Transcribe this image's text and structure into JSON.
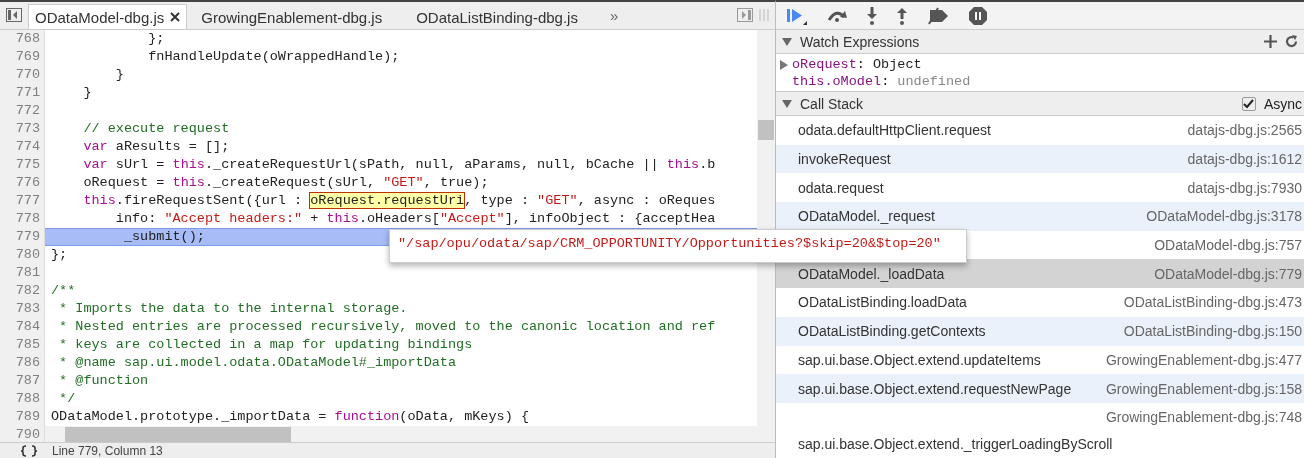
{
  "tabs": [
    {
      "label": "ODataModel-dbg.js",
      "selected": true,
      "closable": true
    },
    {
      "label": "GrowingEnablement-dbg.js",
      "selected": false,
      "closable": false
    },
    {
      "label": "ODataListBinding-dbg.js",
      "selected": false,
      "closable": false
    }
  ],
  "more_tabs": "»",
  "code": {
    "lines": [
      {
        "n": "768",
        "selected": false,
        "tokens": [
          {
            "kind": "plain",
            "text": "            };"
          }
        ]
      },
      {
        "n": "769",
        "selected": false,
        "tokens": [
          {
            "kind": "plain",
            "text": "            fnHandleUpdate(oWrappedHandle);"
          }
        ]
      },
      {
        "n": "770",
        "selected": false,
        "tokens": [
          {
            "kind": "plain",
            "text": "        }"
          }
        ]
      },
      {
        "n": "771",
        "selected": false,
        "tokens": [
          {
            "kind": "plain",
            "text": "    }"
          }
        ]
      },
      {
        "n": "772",
        "selected": false
      },
      {
        "n": "773",
        "selected": false,
        "tokens": [
          {
            "kind": "comment",
            "text": "    // execute request"
          }
        ]
      },
      {
        "n": "774",
        "selected": false,
        "tokens": [
          {
            "kind": "keyword",
            "text": "    var"
          },
          {
            "kind": "plain",
            "text": " aResults = [];"
          }
        ]
      },
      {
        "n": "775",
        "selected": false,
        "tokens": [
          {
            "kind": "keyword",
            "text": "    var"
          },
          {
            "kind": "plain",
            "text": " sUrl = "
          },
          {
            "kind": "keyword",
            "text": "this"
          },
          {
            "kind": "plain",
            "text": "._createRequestUrl(sPath, null, aParams, null, bCache || "
          },
          {
            "kind": "keyword",
            "text": "this"
          },
          {
            "kind": "plain",
            "text": ".b"
          }
        ]
      },
      {
        "n": "776",
        "selected": false,
        "tokens": [
          {
            "kind": "plain",
            "text": "    oRequest = "
          },
          {
            "kind": "keyword",
            "text": "this"
          },
          {
            "kind": "plain",
            "text": "._createRequest(sUrl, "
          },
          {
            "kind": "string",
            "text": "\"GET\""
          },
          {
            "kind": "plain",
            "text": ", true);"
          }
        ]
      },
      {
        "n": "777",
        "selected": false,
        "tokens": [
          {
            "kind": "keyword",
            "text": "    this"
          },
          {
            "kind": "plain",
            "text": ".fireRequestSent({url : "
          },
          {
            "kind": "hover",
            "text": "oRequest.requestUri"
          },
          {
            "kind": "plain",
            "text": ", type : "
          },
          {
            "kind": "string",
            "text": "\"GET\""
          },
          {
            "kind": "plain",
            "text": ", async : oReques"
          }
        ]
      },
      {
        "n": "778",
        "selected": false,
        "tokens": [
          {
            "kind": "plain",
            "text": "        info: "
          },
          {
            "kind": "string",
            "text": "\"Accept headers:\""
          },
          {
            "kind": "plain",
            "text": " + "
          },
          {
            "kind": "keyword",
            "text": "this"
          },
          {
            "kind": "plain",
            "text": ".oHeaders["
          },
          {
            "kind": "string",
            "text": "\"Accept\""
          },
          {
            "kind": "plain",
            "text": "], infoObject : {acceptHea"
          }
        ]
      },
      {
        "n": "779",
        "selected": true,
        "tokens": [
          {
            "kind": "plain",
            "text": "         _submit();"
          }
        ]
      },
      {
        "n": "780",
        "selected": false,
        "tokens": [
          {
            "kind": "plain",
            "text": "};"
          }
        ]
      },
      {
        "n": "781",
        "selected": false
      },
      {
        "n": "782",
        "selected": false,
        "tokens": [
          {
            "kind": "comment",
            "text": "/**"
          }
        ]
      },
      {
        "n": "783",
        "selected": false,
        "tokens": [
          {
            "kind": "comment",
            "text": " * Imports the data to the internal storage."
          }
        ]
      },
      {
        "n": "784",
        "selected": false,
        "tokens": [
          {
            "kind": "comment",
            "text": " * Nested entries are processed recursively, moved to the canonic location and ref"
          }
        ]
      },
      {
        "n": "785",
        "selected": false,
        "tokens": [
          {
            "kind": "comment",
            "text": " * keys are collected in a map for updating bindings"
          }
        ]
      },
      {
        "n": "786",
        "selected": false,
        "tokens": [
          {
            "kind": "comment",
            "text": " * @name sap.ui.model.odata.ODataModel#_importData"
          }
        ]
      },
      {
        "n": "787",
        "selected": false,
        "tokens": [
          {
            "kind": "comment",
            "text": " * @function"
          }
        ]
      },
      {
        "n": "788",
        "selected": false,
        "tokens": [
          {
            "kind": "comment",
            "text": " */"
          }
        ]
      },
      {
        "n": "789",
        "selected": false,
        "tokens": [
          {
            "kind": "plain",
            "text": "ODataModel.prototype._importData = "
          },
          {
            "kind": "keyword",
            "text": "function"
          },
          {
            "kind": "plain",
            "text": "(oData, mKeys) {"
          }
        ]
      }
    ],
    "last_line_number": "790",
    "tooltip": "\"/sap/opu/odata/sap/CRM_OPPORTUNITY/Opportunities?$skip=20&$top=20\""
  },
  "status_bar": {
    "position": "Line 779, Column 13"
  },
  "watch": {
    "title": "Watch Expressions",
    "expanded": true,
    "items": [
      {
        "name": "oRequest",
        "separator": ":",
        "value": "Object",
        "kind": "object"
      },
      {
        "name": "this.oModel",
        "separator": ":",
        "value": "undefined",
        "kind": "undefined"
      }
    ]
  },
  "call_stack": {
    "title": "Call Stack",
    "expanded": true,
    "async_label": "Async",
    "async_checked": true,
    "frames": [
      {
        "name": "odata.defaultHttpClient.request",
        "file": "datajs-dbg.js:2565",
        "selected": false
      },
      {
        "name": "invokeRequest",
        "file": "datajs-dbg.js:1612",
        "selected": false
      },
      {
        "name": "odata.request",
        "file": "datajs-dbg.js:7930",
        "selected": false
      },
      {
        "name": "ODataModel._request",
        "file": "ODataModel-dbg.js:3178",
        "selected": false
      },
      {
        "file": "ODataModel-dbg.js:757",
        "selected": false
      },
      {
        "name": "ODataModel._loadData",
        "file": "ODataModel-dbg.js:779",
        "selected": true
      },
      {
        "name": "ODataListBinding.loadData",
        "file": "ODataListBinding-dbg.js:473",
        "selected": false
      },
      {
        "name": "ODataListBinding.getContexts",
        "file": "ODataListBinding-dbg.js:150",
        "selected": false
      },
      {
        "name": "sap.ui.base.Object.extend.updateItems",
        "file": "GrowingEnablement-dbg.js:477",
        "selected": false
      },
      {
        "name": "sap.ui.base.Object.extend.requestNewPage",
        "file": "GrowingEnablement-dbg.js:158",
        "selected": false
      },
      {
        "name": "sap.ui.base.Object.extend._triggerLoadingByScroll",
        "file": "GrowingEnablement-dbg.js:748",
        "selected": false,
        "wrapped": true
      }
    ]
  }
}
